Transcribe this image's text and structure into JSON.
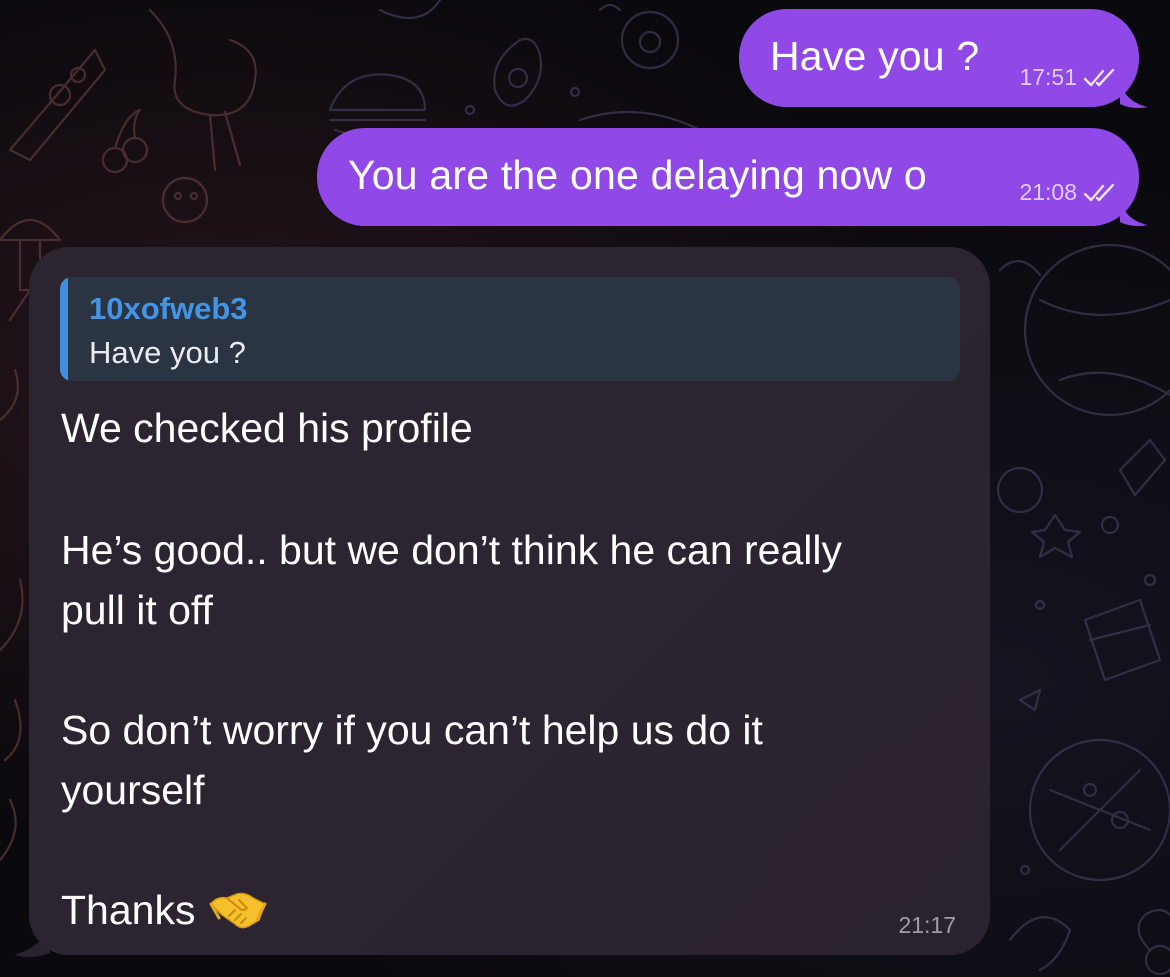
{
  "messages": {
    "outgoing": [
      {
        "text": "Have you ?",
        "time": "17:51",
        "status_icon": "double-check-icon"
      },
      {
        "text": "You are the one delaying now o",
        "time": "21:08",
        "status_icon": "double-check-icon"
      }
    ],
    "incoming": {
      "reply": {
        "name": "10xofweb3",
        "text": "Have you ?"
      },
      "lines": [
        "We checked his profile",
        "He’s good.. but we don’t think he can really",
        "pull it off",
        "So don’t worry if you can’t help us do it",
        "yourself",
        "Thanks"
      ],
      "emoji": "handshake-icon",
      "time": "21:17"
    }
  },
  "colors": {
    "outgoing_bubble": "#9048e6",
    "incoming_bubble": "#2c2530",
    "reply_accent": "#3f8ee0",
    "reply_name": "#4494e6",
    "background": "#0a090d"
  }
}
